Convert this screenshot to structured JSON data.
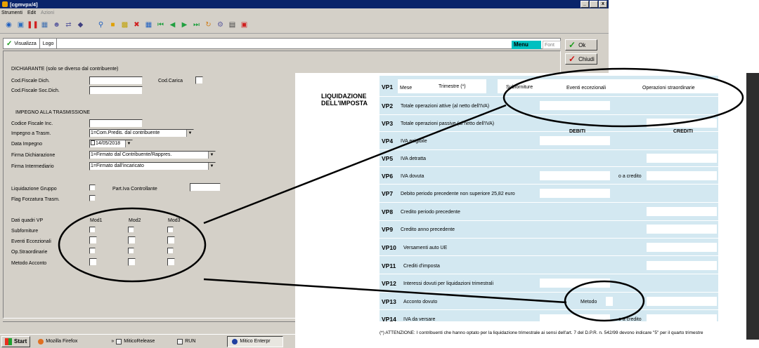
{
  "window": {
    "title": "[cgmvpx/4]",
    "btn_min": "_",
    "btn_max": " ",
    "btn_close": "x"
  },
  "menu": {
    "strumenti": "Strumenti",
    "edit": "Edit",
    "azioni": "Azioni"
  },
  "tabs": {
    "visualizza": "Visualizza",
    "logo": "Logo"
  },
  "panel": {
    "menu_label": "Menu",
    "font_label": "Font",
    "ok_label": "Ok",
    "chiudi_label": "Chiudi"
  },
  "form": {
    "dichiarante_header": "DICHIARANTE (solo se diverso dal contribuente)",
    "cod_fiscale_dich": "Cod.Fiscale Dich.",
    "cod_carica": "Cod.Carica",
    "cod_fiscale_soc_dich": "Cod.Fiscale Soc.Dich.",
    "impegno_header": "IMPEGNO ALLA TRASMISSIONE",
    "codice_fiscale_inc": "Codice Fiscale Inc.",
    "impegno_a_trasm": "Impegno a Trasm.",
    "impegno_a_trasm_value": "1=Com.Predis. dal contribuente",
    "data_impegno": "Data Impegno",
    "data_impegno_value": "14/05/2018",
    "firma_dichiarazione": "Firma Dichiarazione",
    "firma_dichiarazione_value": "1=Firmato dal Contribuente/Rappres.",
    "firma_intermediario": "Firma Intermediario",
    "firma_intermediario_value": "1=Firmato dall'incaricato",
    "liquidazione_gruppo": "Liquidazione Gruppo",
    "part_iva_controllante": "Part.Iva Controllante",
    "flag_forzatura": "Flag Forzatura Trasm.",
    "dati_quadri_vp": "Dati quadri VP",
    "mod1": "Mod1",
    "mod2": "Mod2",
    "mod3": "Mod3",
    "subforniture": "Subforniture",
    "eventi_eccezionali": "Eventi Eccezionali",
    "op_straordinarie": "Op.Straordinarie",
    "metodo_acconto": "Metodo Acconto"
  },
  "taskbar": {
    "start": "Start",
    "firefox": "Mozilla Firefox",
    "mitico_release": "MiticoRelease",
    "run": "RUN",
    "mitico_enterprise": "Mitico Enterpr",
    "chevron": "»"
  },
  "tax_form": {
    "section_title_1": "LIQUIDAZIONE",
    "section_title_2": "DELL'IMPOSTA",
    "vp1": {
      "code": "VP1",
      "mese": "Mese",
      "trimestre": "Trimestre (*)",
      "subforniture": "Subforniture",
      "eventi": "Eventi eccezionali",
      "operazioni": "Operazioni straordinarie"
    },
    "vp2": {
      "code": "VP2",
      "text": "Totale operazioni attive (al netto dell'IVA)"
    },
    "vp3": {
      "code": "VP3",
      "text": "Totale operazioni passive (al netto dell'IVA)"
    },
    "debiti": "DEBITI",
    "crediti": "CREDITI",
    "vp4": {
      "code": "VP4",
      "text": "IVA esigibile"
    },
    "vp5": {
      "code": "VP5",
      "text": "IVA detratta"
    },
    "vp6": {
      "code": "VP6",
      "text": "IVA dovuta",
      "extra": "o a credito"
    },
    "vp7": {
      "code": "VP7",
      "text": "Debito periodo precedente non superiore 25,82 euro"
    },
    "vp8": {
      "code": "VP8",
      "text": "Credito periodo precedente"
    },
    "vp9": {
      "code": "VP9",
      "text": "Credito anno precedente"
    },
    "vp10": {
      "code": "VP10",
      "text": "Versamenti auto UE"
    },
    "vp11": {
      "code": "VP11",
      "text": "Crediti d'imposta"
    },
    "vp12": {
      "code": "VP12",
      "text": "Interessi dovuti per liquidazioni trimestrali"
    },
    "vp13": {
      "code": "VP13",
      "text": "Acconto dovuto",
      "metodo": "Metodo"
    },
    "vp14": {
      "code": "VP14",
      "text": "IVA da versare",
      "extra": "o a credito"
    },
    "footnote": "(*) ATTENZIONE: I contribuenti che hanno optato per la liquidazione trimestrale ai sensi dell'art. 7 del D.P.R. n. 542/99 devono indicare \"5\" per il quarto trimestre"
  }
}
